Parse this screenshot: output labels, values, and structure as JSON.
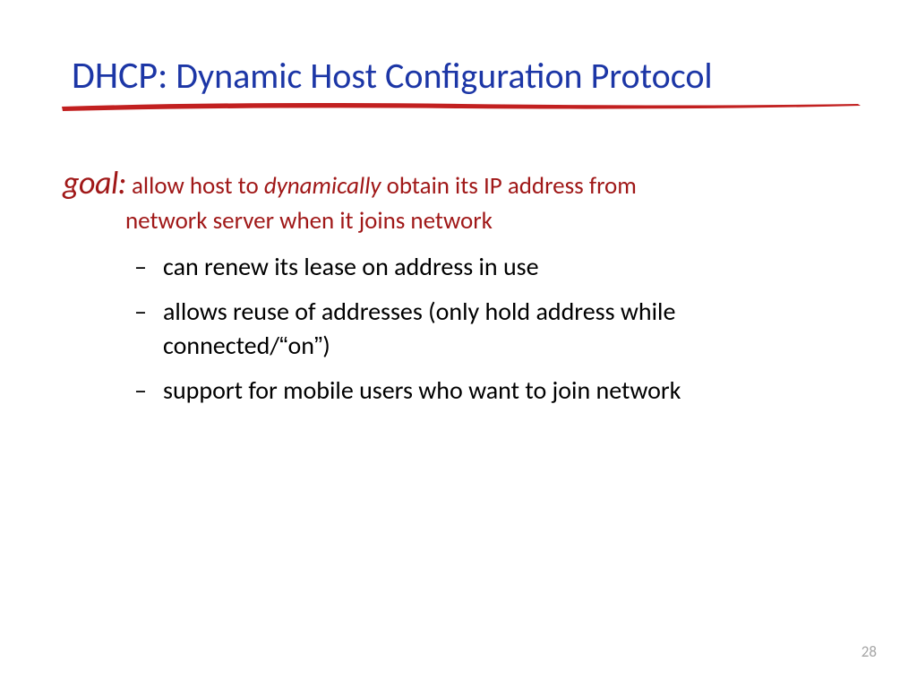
{
  "title": {
    "prefix": "DHCP:",
    "rest": " Dynamic Host Configuration Protocol"
  },
  "goal": {
    "label": "goal:",
    "part1": " allow host to ",
    "em": "dynamically",
    "part2": " obtain its IP address from",
    "line2": "network server when it joins network"
  },
  "bullets": [
    {
      "text": "can renew its lease on address in use"
    },
    {
      "pre": "allows reuse of addresses (only hold address while connected/",
      "lq": "“",
      "mid": "on",
      "rq": "”",
      "post": ")"
    },
    {
      "text": "support for mobile users who want to join network"
    }
  ],
  "page": "28",
  "colors": {
    "title": "#1c36a6",
    "accent": "#a01818",
    "underline": "#c22020",
    "pagenum": "#a6a6a6"
  }
}
